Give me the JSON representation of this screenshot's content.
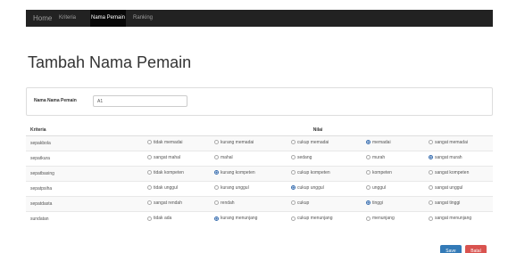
{
  "nav": {
    "home": "Home",
    "kriteria": "Kriteria",
    "nama_pemain": "Nama Pemain",
    "ranking": "Ranking"
  },
  "page_title": "Tambah Nama Pemain",
  "form": {
    "label": "Nama Nama Pemain",
    "value": "A1"
  },
  "table": {
    "headers": {
      "kriteria": "Kriteria",
      "nilai": "Nilai"
    },
    "rows": [
      {
        "kriteria": "sepakbola",
        "options": [
          "tidak memadai",
          "kurang memadai",
          "cukup memadai",
          "memadai",
          "sangat memadai"
        ],
        "selected": 3
      },
      {
        "kriteria": "sepatkura",
        "options": [
          "sangat mahal",
          "mahal",
          "sedang",
          "murah",
          "sangat murah"
        ],
        "selected": 4
      },
      {
        "kriteria": "sepatbasing",
        "options": [
          "tidak kompeten",
          "kurang kompeten",
          "cukup kompeten",
          "kompeten",
          "sangat kompeten"
        ],
        "selected": 1
      },
      {
        "kriteria": "sepatpsiha",
        "options": [
          "tidak unggul",
          "kurang unggul",
          "cukup unggul",
          "unggul",
          "sangat unggul"
        ],
        "selected": 2
      },
      {
        "kriteria": "sepatdasta",
        "options": [
          "sangat rendah",
          "rendah",
          "cukup",
          "tinggi",
          "sangat tinggi"
        ],
        "selected": 3
      },
      {
        "kriteria": "sundatan",
        "options": [
          "tidak ada",
          "kurang menunjang",
          "cukup menunjang",
          "menunjang",
          "sangat menunjang"
        ],
        "selected": 1
      }
    ]
  },
  "buttons": {
    "save": "Save",
    "back": "Batal"
  },
  "colors": {
    "navbar": "#222222",
    "primary": "#337ab7",
    "danger": "#d9534f",
    "radio_selected": "#3a6fb0"
  }
}
